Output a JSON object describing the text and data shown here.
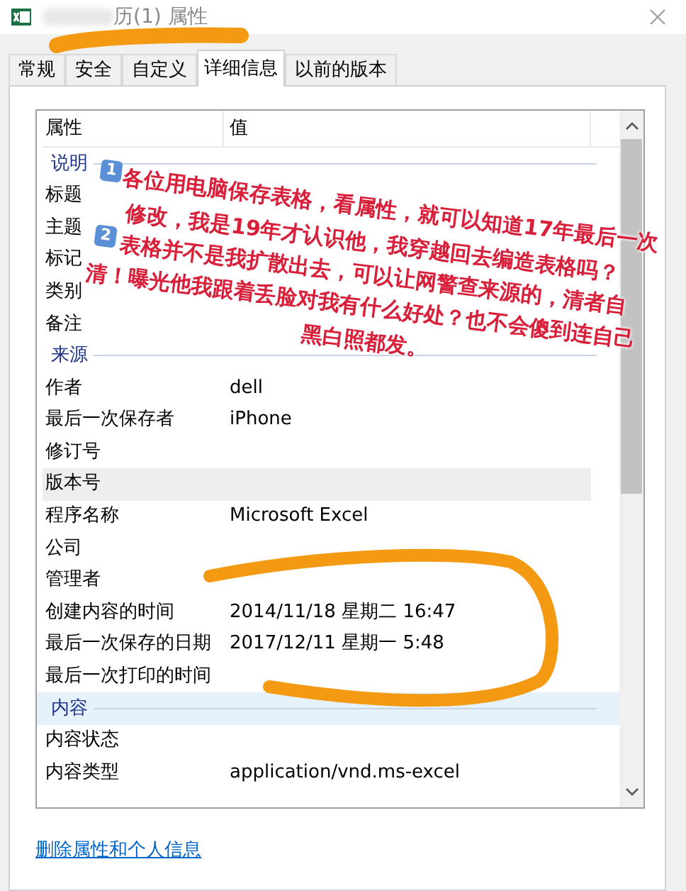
{
  "window": {
    "title": "历(1) 属性"
  },
  "tabs": [
    {
      "label": "常规",
      "selected": false
    },
    {
      "label": "安全",
      "selected": false
    },
    {
      "label": "自定义",
      "selected": false
    },
    {
      "label": "详细信息",
      "selected": true
    },
    {
      "label": "以前的版本",
      "selected": false
    }
  ],
  "table": {
    "columns": [
      "属性",
      "值"
    ],
    "rows": [
      {
        "kind": "group",
        "name": "说明",
        "selected": false,
        "hover": false
      },
      {
        "kind": "row",
        "name": "标题",
        "selected": false,
        "hover": false
      },
      {
        "kind": "row",
        "name": "主题",
        "selected": false,
        "hover": false
      },
      {
        "kind": "row",
        "name": "标记",
        "selected": false,
        "hover": false
      },
      {
        "kind": "row",
        "name": "类别",
        "selected": false,
        "hover": false
      },
      {
        "kind": "row",
        "name": "备注",
        "selected": false,
        "hover": false
      },
      {
        "kind": "group",
        "name": "来源",
        "selected": false,
        "hover": false
      },
      {
        "kind": "row",
        "name": "作者",
        "value": "dell",
        "selected": false,
        "hover": false
      },
      {
        "kind": "row",
        "name": "最后一次保存者",
        "value": "iPhone",
        "selected": false,
        "hover": false
      },
      {
        "kind": "row",
        "name": "修订号",
        "selected": false,
        "hover": false
      },
      {
        "kind": "row",
        "name": "版本号",
        "selected": false,
        "hover": true
      },
      {
        "kind": "row",
        "name": "程序名称",
        "value": "Microsoft Excel",
        "selected": false,
        "hover": false
      },
      {
        "kind": "row",
        "name": "公司",
        "selected": false,
        "hover": false
      },
      {
        "kind": "row",
        "name": "管理者",
        "selected": false,
        "hover": false
      },
      {
        "kind": "row",
        "name": "创建内容的时间",
        "value": "2014/11/18 星期二 16:47",
        "selected": false,
        "hover": false
      },
      {
        "kind": "row",
        "name": "最后一次保存的日期",
        "value": "2017/12/11 星期一 5:48",
        "selected": false,
        "hover": false
      },
      {
        "kind": "row",
        "name": "最后一次打印的时间",
        "selected": false,
        "hover": false
      },
      {
        "kind": "group",
        "name": "内容",
        "selected": true,
        "hover": false
      },
      {
        "kind": "row",
        "name": "内容状态",
        "selected": false,
        "hover": false
      },
      {
        "kind": "row",
        "name": "内容类型",
        "value": "application/vnd.ms-excel",
        "selected": false,
        "hover": false
      }
    ]
  },
  "link": "删除属性和个人信息",
  "annotation": {
    "notes": [
      {
        "badge": "1",
        "lines": [
          "各位用电脑保存表格，看属性，就可以知道17年最后一次",
          "修改，我是19年才认识他，我穿越回去编造表格吗？"
        ]
      },
      {
        "badge": "2",
        "lines": [
          "表格并不是我扩散出去，可以让网警查来源的，清者自",
          "清！曝光他我跟着丢脸对我有什么好处？也不会傻到连自己",
          "黑白照都发。"
        ]
      }
    ]
  }
}
